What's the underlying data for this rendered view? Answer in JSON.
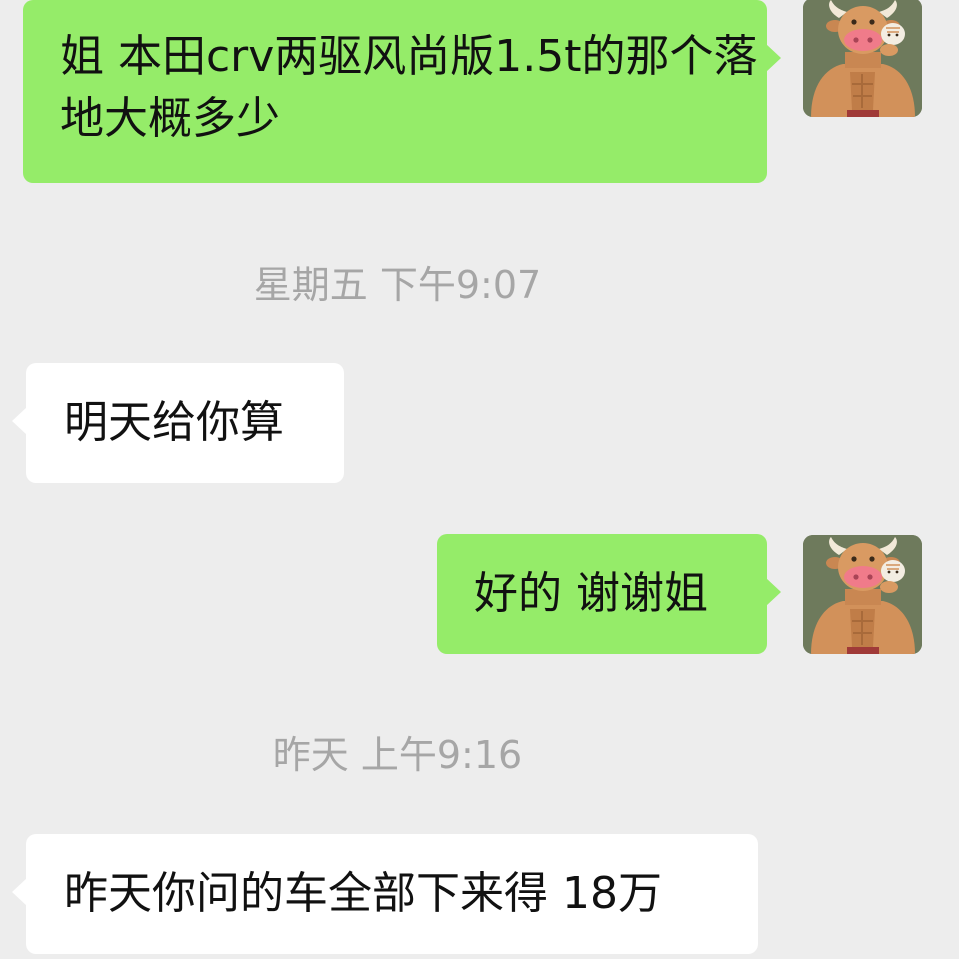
{
  "chat": {
    "messages": [
      {
        "type": "outgoing",
        "text": "姐 本田crv两驱风尚版1.5t的那个落地大概多少"
      },
      {
        "type": "timestamp",
        "text": "星期五 下午9:07"
      },
      {
        "type": "incoming",
        "text": "明天给你算"
      },
      {
        "type": "outgoing",
        "text": "好的 谢谢姐"
      },
      {
        "type": "timestamp",
        "text": "昨天 上午9:16"
      },
      {
        "type": "incoming",
        "text": "昨天你问的车全部下来得 18万"
      }
    ]
  },
  "avatar": {
    "icon": "muscular-bull-cartoon-avatar",
    "background": "#6e7a5c"
  },
  "colors": {
    "background": "#ededed",
    "outgoing_bubble": "#95ec69",
    "incoming_bubble": "#ffffff",
    "timestamp_text": "#a6a6a6"
  }
}
